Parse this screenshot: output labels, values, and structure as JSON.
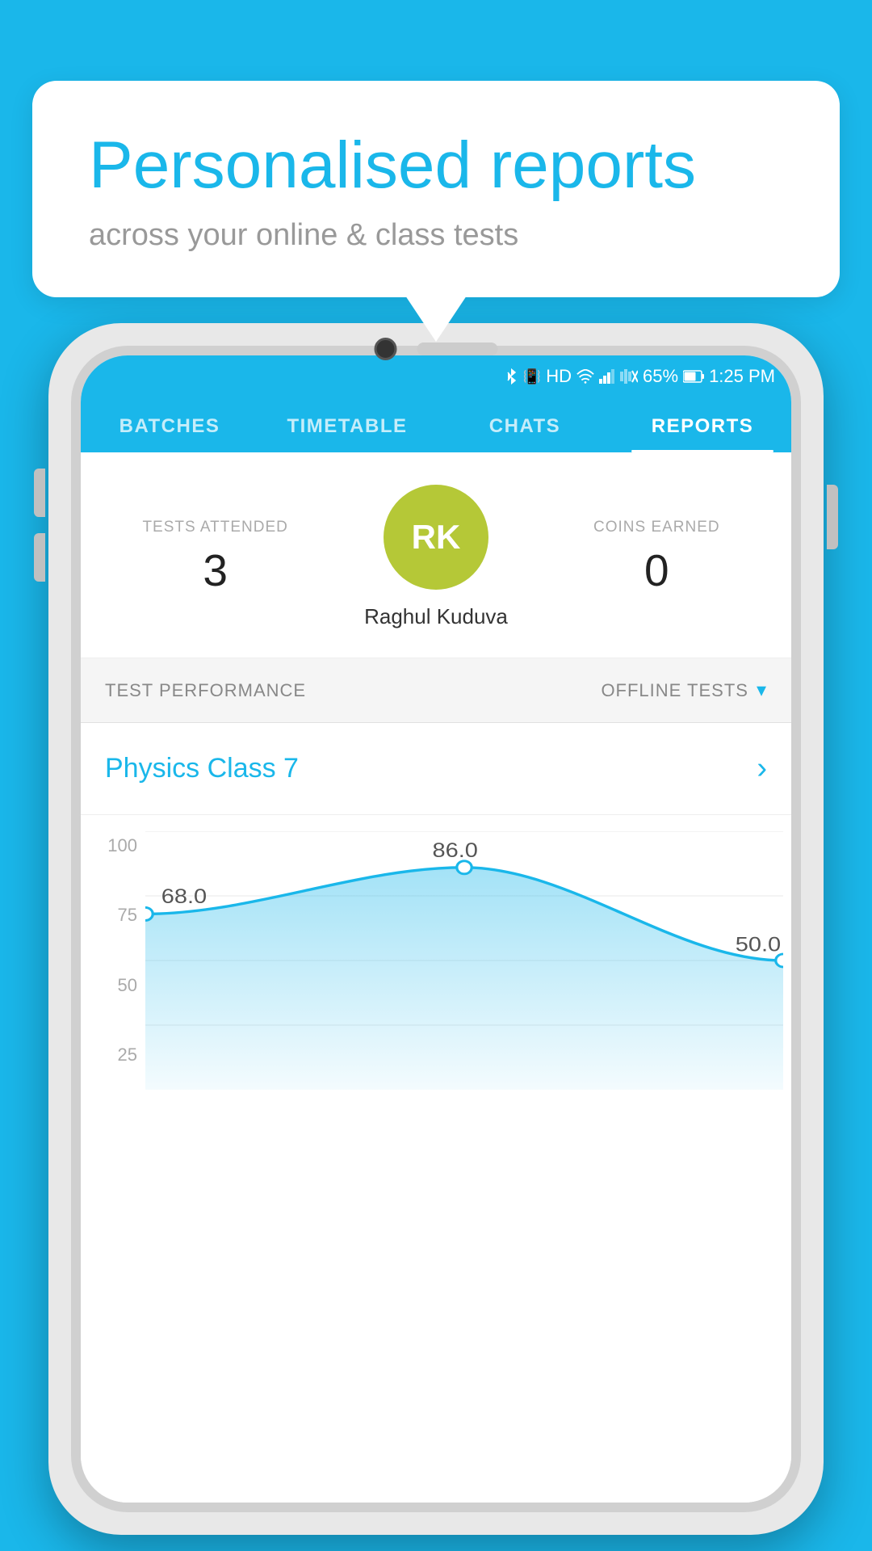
{
  "background_color": "#1ab7ea",
  "speech_bubble": {
    "title": "Personalised reports",
    "subtitle": "across your online & class tests"
  },
  "status_bar": {
    "time": "1:25 PM",
    "battery": "65%",
    "icons": [
      "bluetooth",
      "vibrate",
      "hd",
      "wifi",
      "signal",
      "mute"
    ]
  },
  "nav": {
    "tabs": [
      {
        "label": "BATCHES",
        "active": false
      },
      {
        "label": "TIMETABLE",
        "active": false
      },
      {
        "label": "CHATS",
        "active": false
      },
      {
        "label": "REPORTS",
        "active": true
      }
    ]
  },
  "user_stats": {
    "tests_attended_label": "TESTS ATTENDED",
    "tests_attended_value": "3",
    "avatar_initials": "RK",
    "user_name": "Raghul Kuduva",
    "coins_earned_label": "COINS EARNED",
    "coins_earned_value": "0"
  },
  "test_performance": {
    "section_label": "TEST PERFORMANCE",
    "filter_label": "OFFLINE TESTS",
    "class_name": "Physics Class 7"
  },
  "chart": {
    "y_labels": [
      "100",
      "75",
      "50",
      "25"
    ],
    "data_points": [
      {
        "x": 0,
        "y": 68.0,
        "label": "68.0"
      },
      {
        "x": 1,
        "y": 86.0,
        "label": "86.0"
      },
      {
        "x": 2,
        "y": 50.0,
        "label": "50.0"
      }
    ]
  },
  "phone": {
    "camera_visible": true,
    "speaker_visible": true
  }
}
